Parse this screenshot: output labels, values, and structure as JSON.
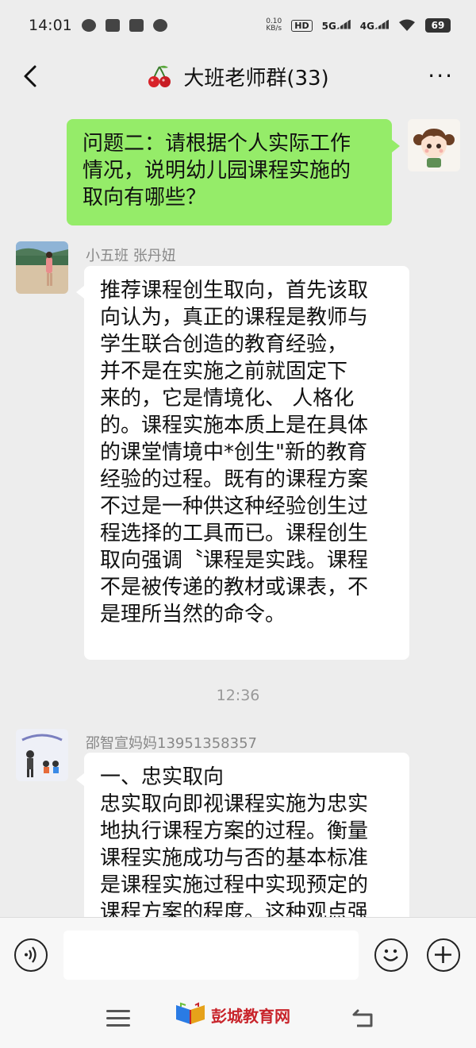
{
  "status_bar": {
    "time": "14:01",
    "net_rate_value": "0.10",
    "net_rate_unit": "KB/s",
    "hd_label": "HD",
    "signal1_label": "5G",
    "signal2_label": "4G",
    "battery": "69"
  },
  "header": {
    "title": "大班老师群(33)"
  },
  "messages": {
    "own": {
      "text": "问题二：请根据个人实际工作\n情况，说明幼儿园课程实施的\n取向有哪些？"
    },
    "msg1": {
      "sender": "小五班 张丹妞",
      "text": "推荐课程创生取向，首先该取\n向认为，真正的课程是教师与\n学生联合创造的教育经验，\n并不是在实施之前就固定下\n来的，它是情境化、 人格化\n的。课程实施本质上是在具体\n的课堂情境中*创生\"新的教育\n经验的过程。既有的课程方案\n不过是一种供这种经验创生过\n程选择的工具而已。课程创生\n取向强调〝课程是实践。课程\n不是被传递的教材或课表，不\n是理所当然的命令。"
    },
    "time_separator": "12:36",
    "msg2": {
      "sender": "邵智宣妈妈13951358357",
      "text": "一、忠实取向\n忠实取向即视课程实施为忠实\n地执行课程方案的过程。衡量\n课程实施成功与否的基本标准\n是课程实施过程中实现预定的\n课程方案的程度。这种观点强"
    }
  },
  "watermark": {
    "brand": "彭城教育网"
  },
  "colors": {
    "own_bubble": "#95ec69",
    "other_bubble": "#ffffff",
    "background": "#ededed"
  }
}
